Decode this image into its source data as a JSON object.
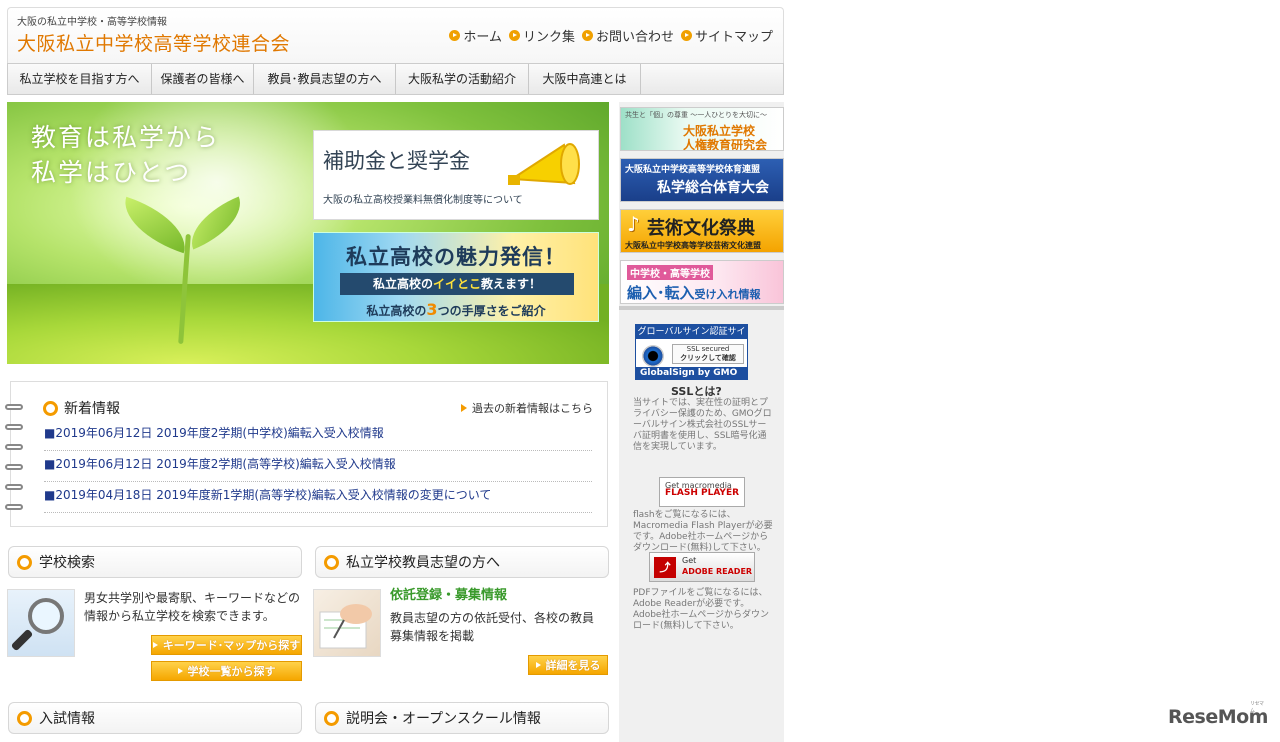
{
  "header": {
    "tagline": "大阪の私立中学校・高等学校情報",
    "site_title": "大阪私立中学校高等学校連合会",
    "links": [
      "ホーム",
      "リンク集",
      "お問い合わせ",
      "サイトマップ"
    ]
  },
  "nav": [
    "私立学校を目指す方へ",
    "保護者の皆様へ",
    "教員･教員志望の方へ",
    "大阪私学の活動紹介",
    "大阪中高連とは"
  ],
  "hero": {
    "catch_line1": "教育は私学から",
    "catch_line2": "私学はひとつ",
    "banner1_title": "補助金と奨学金",
    "banner1_sub": "大阪の私立高校授業料無償化制度等について",
    "banner2_title": "私立高校の魅力発信！",
    "banner2_ribbon_pre": "私立高校の",
    "banner2_ribbon_hl": "イイとこ",
    "banner2_ribbon_post": "教えます！",
    "banner2_sub_pre": "私立高校の",
    "banner2_sub_num": "3",
    "banner2_sub_post": "つの手厚さをご紹介"
  },
  "news": {
    "title": "新着情報",
    "past_link": "過去の新着情報はこちら",
    "items": [
      "■2019年06月12日 2019年度2学期(中学校)編転入受入校情報",
      "■2019年06月12日 2019年度2学期(高等学校)編転入受入校情報",
      "■2019年04月18日 2019年度新1学期(高等学校)編転入受入校情報の変更について"
    ]
  },
  "school_search": {
    "title": "学校検索",
    "text": "男女共学別や最寄駅、キーワードなどの情報から私立学校を検索できます。",
    "btn_keyword": "キーワード･マップから探す",
    "btn_list": "学校一覧から探す"
  },
  "teacher": {
    "title": "私立学校教員志望の方へ",
    "sub_title": "依託登録・募集情報",
    "text": "教員志望の方の依託受付、各校の教員募集情報を掲載",
    "btn_detail": "詳細を見る"
  },
  "bottom_boxes": [
    "入試情報",
    "説明会・オープンスクール情報"
  ],
  "sidebar": {
    "banner_jinken_top": "共生と「個」の尊重 〜一人ひとりを大切に〜",
    "banner_jinken_line1": "大阪私立学校",
    "banner_jinken_line2": "人権教育研究会",
    "banner_taiiku_top": "大阪私立中学校高等学校体育連盟",
    "banner_taiiku_main": "私学総合体育大会",
    "banner_geijutsu_main": "芸術文化祭典",
    "banner_geijutsu_sub": "大阪私立中学校高等学校芸術文化連盟",
    "banner_hennyu_top": "中学校・高等学校",
    "banner_hennyu_main": "編入･転入",
    "banner_hennyu_post": "受け入れ情報",
    "gs_top": "グローバルサイン認証サイト",
    "gs_ssl1": "SSL secured",
    "gs_ssl2": "クリックして確認",
    "gs_bottom": "GlobalSign by GMO",
    "ssl_title": "SSLとは?",
    "ssl_text": "当サイトでは、実在性の証明とプライバシー保護のため、GMOグローバルサイン株式会社のSSLサーバ証明書を使用し、SSL暗号化通信を実現しています。",
    "flash_badge_1": "Get macromedia",
    "flash_badge_2": "FLASH PLAYER",
    "flash_text": "flashをご覧になるには、Macromedia Flash Playerが必要です。Adobe社ホームページからダウンロード(無料)して下さい。",
    "adobe_badge_1": "Get",
    "adobe_badge_2": "ADOBE READER",
    "pdf_text": "PDFファイルをご覧になるには、Adobe Readerが必要です。Adobe社ホームページからダウンロード(無料)して下さい。"
  },
  "watermark": "ReseMom",
  "watermark_mini": "リセマム",
  "colors": {
    "accent": "#f49b00",
    "title": "#e07800",
    "link": "#203a8c"
  }
}
